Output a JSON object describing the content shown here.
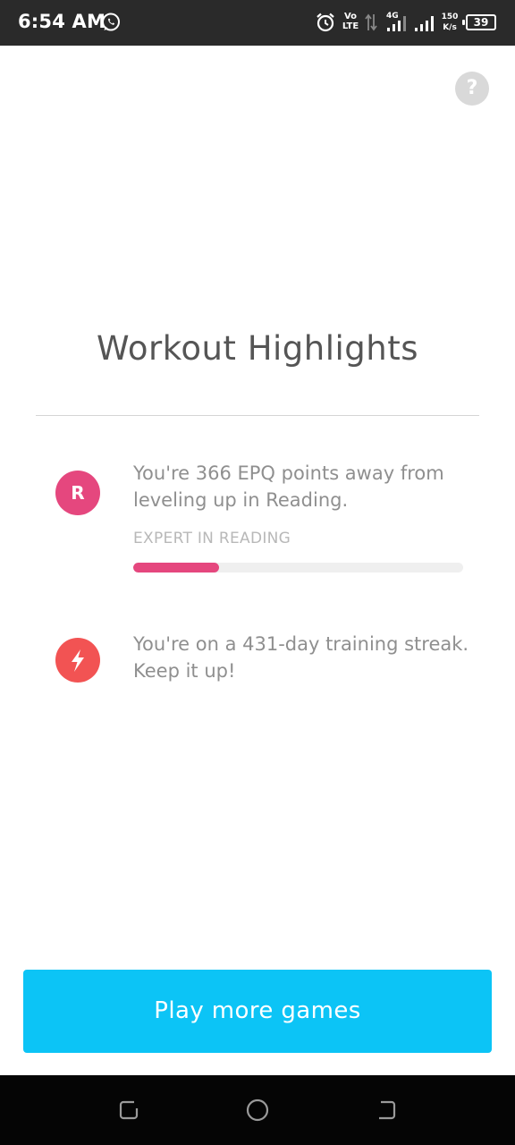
{
  "status_bar": {
    "time": "6:54 AM",
    "volte": [
      "Vo",
      "LTE"
    ],
    "network_type": "4G",
    "speed_value": "150",
    "speed_unit": "K/s",
    "battery_level": "39"
  },
  "help": {
    "label": "?"
  },
  "header": {
    "title": "Workout Highlights"
  },
  "highlights": [
    {
      "icon_letter": "R",
      "icon_color": "#e5477e",
      "text": "You're 366 EPQ points away from leveling up in Reading.",
      "subtitle": "EXPERT IN READING",
      "progress_fraction": 0.26
    },
    {
      "icon": "lightning-icon",
      "icon_color": "#f25353",
      "text": "You're on a 431-day training streak. Keep it up!"
    }
  ],
  "actions": {
    "play_more_label": "Play more games"
  },
  "colors": {
    "accent": "#0cc4f6",
    "reading": "#e5477e",
    "streak": "#f25353"
  }
}
